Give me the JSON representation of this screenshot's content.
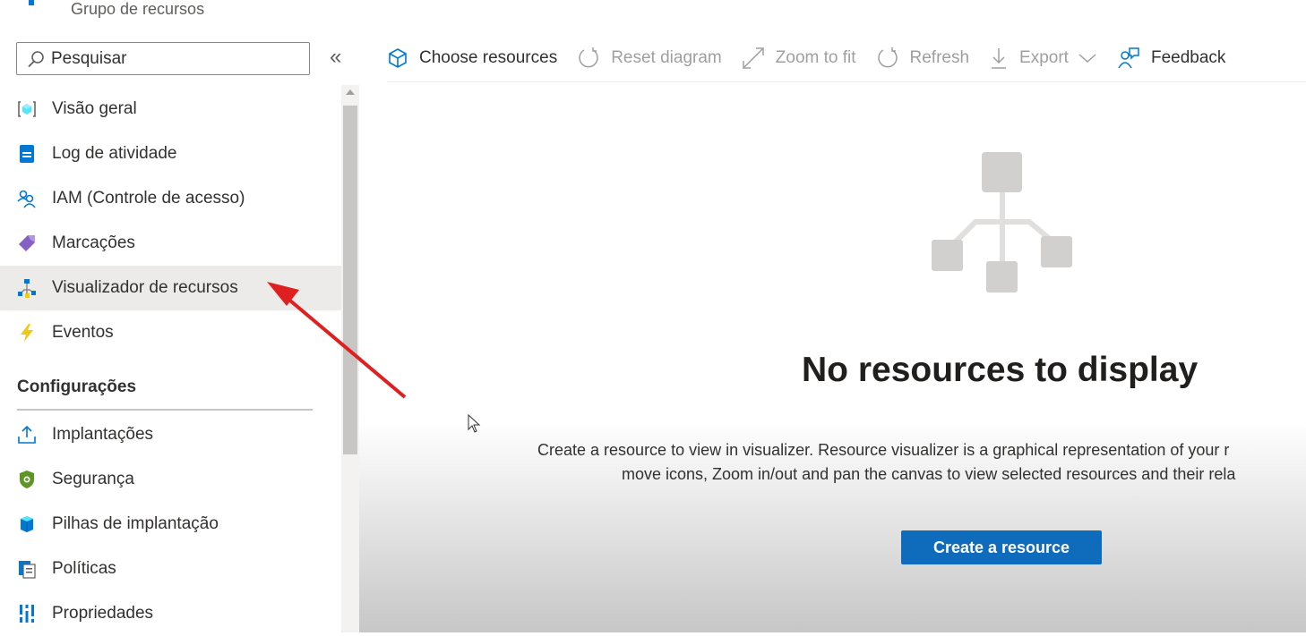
{
  "header": {
    "subtitle": "Grupo de recursos"
  },
  "search": {
    "placeholder": "Pesquisar"
  },
  "sidebar": {
    "items": [
      {
        "label": "Visão geral",
        "icon": "overview-icon"
      },
      {
        "label": "Log de atividade",
        "icon": "activity-log-icon"
      },
      {
        "label": "IAM (Controle de acesso)",
        "icon": "people-icon"
      },
      {
        "label": "Marcações",
        "icon": "tag-icon"
      },
      {
        "label": "Visualizador de recursos",
        "icon": "resource-visualizer-icon",
        "selected": true
      },
      {
        "label": "Eventos",
        "icon": "lightning-icon"
      }
    ],
    "section_title": "Configurações",
    "settings_items": [
      {
        "label": "Implantações",
        "icon": "upload-icon"
      },
      {
        "label": "Segurança",
        "icon": "shield-icon"
      },
      {
        "label": "Pilhas de implantação",
        "icon": "stack-icon"
      },
      {
        "label": "Políticas",
        "icon": "policy-icon"
      },
      {
        "label": "Propriedades",
        "icon": "properties-icon"
      }
    ]
  },
  "toolbar": {
    "choose": "Choose resources",
    "reset": "Reset diagram",
    "zoom": "Zoom to fit",
    "refresh": "Refresh",
    "export": "Export",
    "feedback": "Feedback"
  },
  "empty": {
    "title": "No resources to display",
    "line1": "Create a resource to view in visualizer. Resource visualizer is a graphical representation of your r",
    "line2": "move icons, Zoom in/out and pan the canvas to view selected resources and their rela",
    "button": "Create a resource"
  },
  "colors": {
    "accent": "#0f6cbd",
    "annotation": "#e02020",
    "selected_bg": "#edebe9"
  }
}
